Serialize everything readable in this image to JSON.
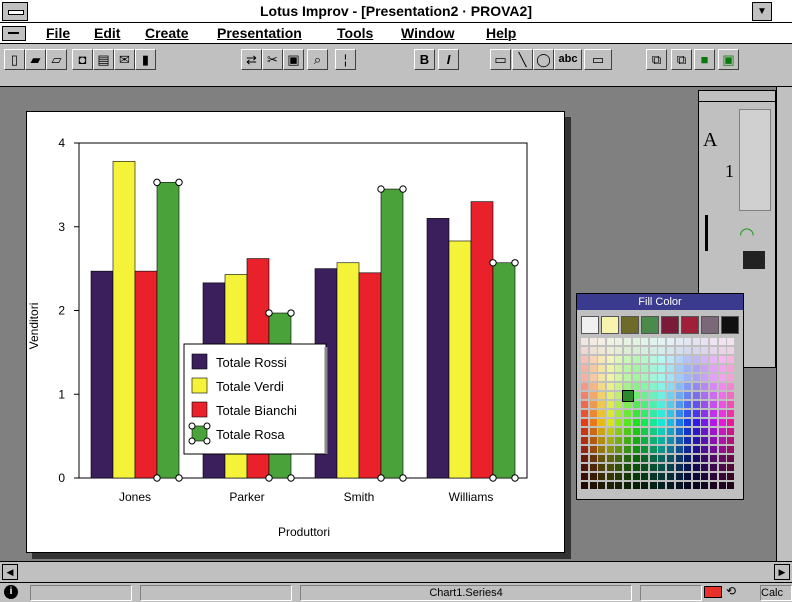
{
  "window": {
    "title": "Lotus Improv - [Presentation2 · PROVA2]"
  },
  "menu": {
    "items": [
      "File",
      "Edit",
      "Create",
      "Presentation",
      "Tools",
      "Window",
      "Help"
    ]
  },
  "toolbar": {
    "buttons": [
      "new-icon",
      "open-icon",
      "open-folder-icon",
      "save-icon",
      "print-icon",
      "envelope-icon",
      "run-icon",
      "swap-icon",
      "scissors-icon",
      "paste-icon",
      "find-icon",
      "format-icon",
      "bold-icon",
      "italic-icon",
      "rectangle-icon",
      "line-icon",
      "ellipse-icon",
      "text-icon",
      "frame-icon",
      "group-icon",
      "ungroup-icon",
      "front-icon",
      "back-icon"
    ],
    "bold_label": "B",
    "italic_label": "I",
    "text_label": "abc"
  },
  "palette": {
    "font_letter": "A",
    "size_digit": "1"
  },
  "fill_color": {
    "title": "Fill Color",
    "top_row": [
      "#f0f0f0",
      "#f8f4b0",
      "#6e6a2a",
      "#4b8a4a",
      "#7a1b3a",
      "#a0203a",
      "#7a6878",
      "#101010"
    ],
    "selected_color": "#2a8a2a"
  },
  "status": {
    "cell": "Chart1.Series4",
    "right_label": "Calc"
  },
  "chart_data": {
    "type": "bar",
    "categories": [
      "Jones",
      "Parker",
      "Smith",
      "Williams"
    ],
    "xlabel": "Produttori",
    "ylabel": "Venditori",
    "ylim": [
      0,
      4
    ],
    "yticks": [
      "0",
      "1",
      "2",
      "3",
      "4"
    ],
    "legend_position": "bottom-left",
    "series": [
      {
        "name": "Totale Rossi",
        "color": "#3a1f5c",
        "values": [
          2.47,
          2.33,
          2.5,
          3.1
        ]
      },
      {
        "name": "Totale Verdi",
        "color": "#f5f23a",
        "values": [
          3.78,
          2.43,
          2.57,
          2.83
        ]
      },
      {
        "name": "Totale Bianchi",
        "color": "#e8212a",
        "values": [
          2.47,
          2.62,
          2.45,
          3.3
        ]
      },
      {
        "name": "Totale Rosa",
        "color": "#4aa33a",
        "values": [
          3.53,
          1.97,
          3.45,
          2.57
        ]
      }
    ],
    "selected_series": "Totale Rosa"
  }
}
